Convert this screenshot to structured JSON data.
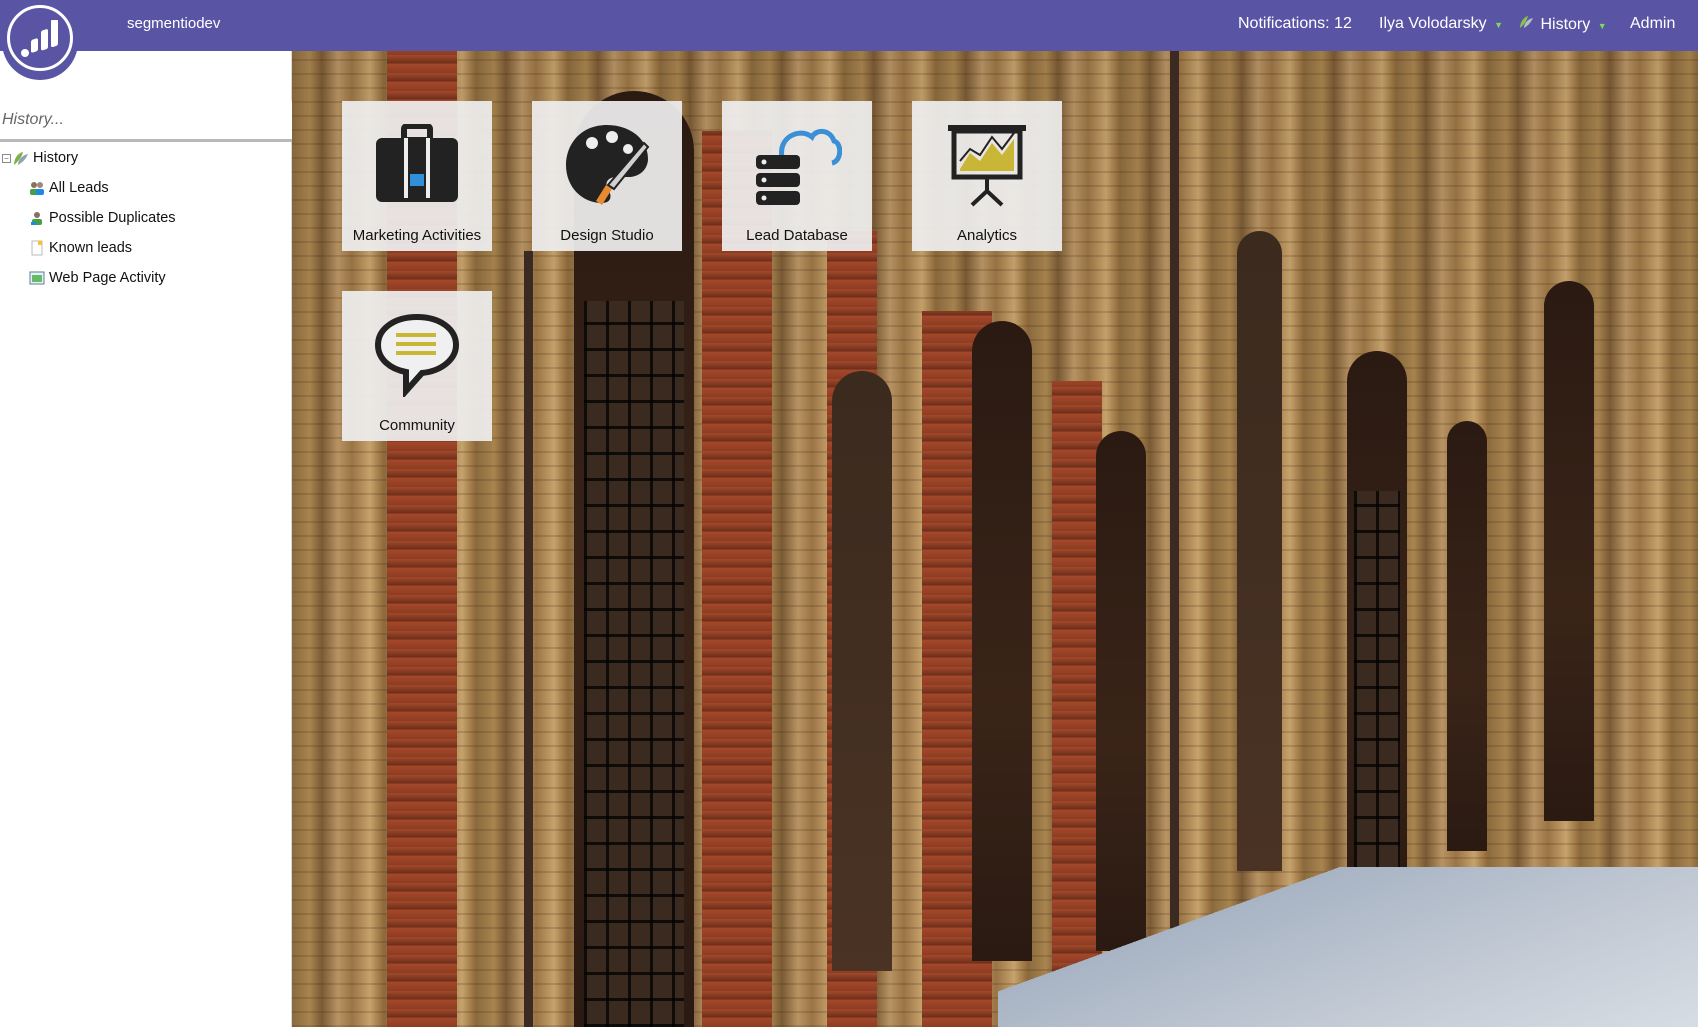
{
  "topbar": {
    "instance_name": "segmentiodev",
    "notifications": "Notifications: 12",
    "user": "Ilya Volodarsky",
    "history": "History",
    "admin": "Admin",
    "accent_color": "#5a54a4"
  },
  "sidebar": {
    "search_placeholder": "History...",
    "tree": {
      "root_label": "History",
      "items": [
        {
          "label": "All Leads",
          "icon": "people-icon"
        },
        {
          "label": "Possible Duplicates",
          "icon": "person-duplicate-icon"
        },
        {
          "label": "Known leads",
          "icon": "document-icon"
        },
        {
          "label": "Web Page Activity",
          "icon": "web-page-icon"
        }
      ]
    }
  },
  "tiles": [
    {
      "label": "Marketing Activities",
      "icon": "briefcase-icon"
    },
    {
      "label": "Design Studio",
      "icon": "palette-icon"
    },
    {
      "label": "Lead Database",
      "icon": "database-cloud-icon"
    },
    {
      "label": "Analytics",
      "icon": "presentation-chart-icon"
    },
    {
      "label": "Community",
      "icon": "chat-bubble-icon"
    }
  ]
}
